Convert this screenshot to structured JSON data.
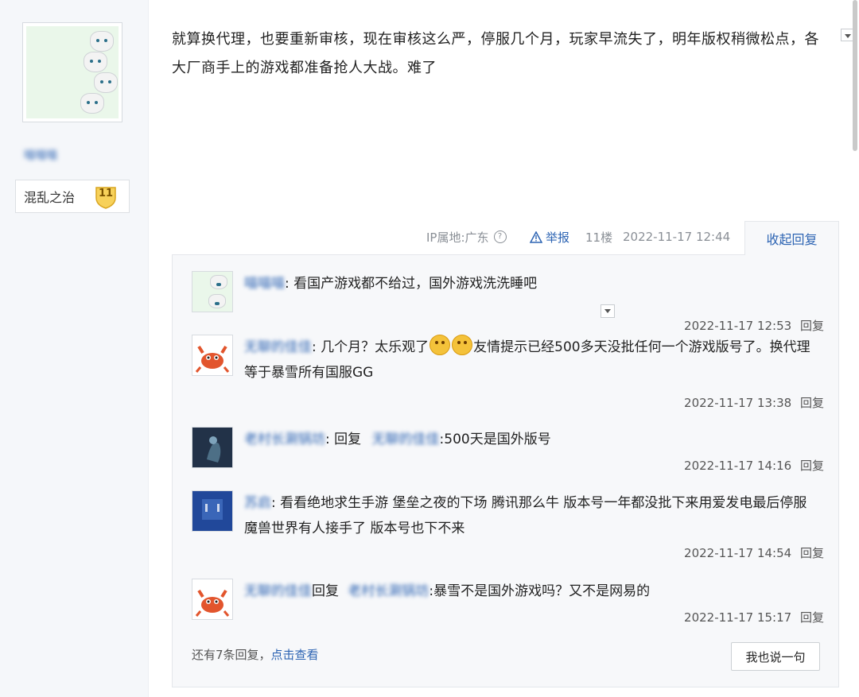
{
  "author": {
    "name": "喵喵喵",
    "rank_title": "混乱之治",
    "level": "11"
  },
  "post": {
    "text": "就算换代理，也要重新审核，现在审核这么严，停服几个月，玩家早流失了，明年版权稍微松点，各大厂商手上的游戏都准备抢人大战。难了",
    "ip_label": "IP属地:广东",
    "report_label": "举报",
    "floor": "11楼",
    "time": "2022-11-17 12:44",
    "collapse_replies_label": "收起回复"
  },
  "replies": [
    {
      "user": "喵喵喵",
      "text": ": 看国产游戏都不给过，国外游戏洗洗睡吧",
      "time": "2022-11-17 12:53",
      "reply_label": "回复"
    },
    {
      "user": "无聊的佳佳",
      "text_a": ": 几个月？太乐观了",
      "text_b": "友情提示已经500多天没批任何一个游戏版号了。换代理等于暴雪所有国服GG",
      "time": "2022-11-17 13:38",
      "reply_label": "回复"
    },
    {
      "user": "老村长涮锅坊",
      "prefix": ": 回复",
      "target": "无聊的佳佳",
      "text": ":500天是国外版号",
      "time": "2022-11-17 14:16",
      "reply_label": "回复"
    },
    {
      "user": "苏启",
      "text": ": 看看绝地求生手游 堡垒之夜的下场 腾讯那么牛 版本号一年都没批下来用爱发电最后停服 魔兽世界有人接手了 版本号也下不来",
      "time": "2022-11-17 14:54",
      "reply_label": "回复"
    },
    {
      "user": "无聊的佳佳",
      "prefix": "回复",
      "target": "老村长涮锅坊",
      "text": ":暴雪不是国外游戏吗？又不是网易的",
      "time": "2022-11-17 15:17",
      "reply_label": "回复"
    }
  ],
  "footer": {
    "more_text": "还有7条回复，",
    "more_link": "点击查看",
    "say_button": "我也说一句"
  }
}
